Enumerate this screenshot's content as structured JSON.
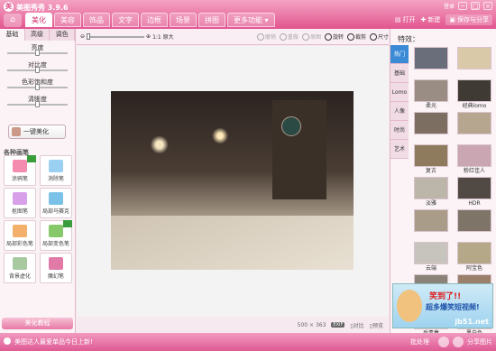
{
  "app": {
    "title": "美图秀秀 3.9.6",
    "logo_glyph": "美"
  },
  "window": {
    "login": "登录",
    "min": "−",
    "max": "□",
    "close": "×"
  },
  "menu_tabs": [
    {
      "label": "美化",
      "active": true
    },
    {
      "label": "美容",
      "active": false
    },
    {
      "label": "饰品",
      "active": false
    },
    {
      "label": "文字",
      "active": false
    },
    {
      "label": "边框",
      "active": false
    },
    {
      "label": "场景",
      "active": false
    },
    {
      "label": "拼图",
      "active": false
    },
    {
      "label": "更多功能 ▾",
      "active": false
    }
  ],
  "actions": {
    "open": "打开",
    "new": "新建",
    "save": "保存与分享"
  },
  "left_panel": {
    "tabs": [
      "基础",
      "高级",
      "调色"
    ],
    "sliders": [
      {
        "label": "亮度",
        "value": 0.5
      },
      {
        "label": "对比度",
        "value": 0.5
      },
      {
        "label": "色彩饱和度",
        "value": 0.5
      },
      {
        "label": "清晰度",
        "value": 0.5
      }
    ],
    "auto_button": "一键美化",
    "section_title": "各种画笔",
    "tools": [
      {
        "label": "涂鸦笔",
        "color": "#f48cb0",
        "hot": true
      },
      {
        "label": "消除笔",
        "color": "#9ad0f2",
        "hot": false
      },
      {
        "label": "抠图笔",
        "color": "#d7a0e8",
        "hot": false
      },
      {
        "label": "局部马赛克",
        "color": "#7bc2e8",
        "hot": false
      },
      {
        "label": "局部彩色笔",
        "color": "#f2b06a",
        "hot": false
      },
      {
        "label": "局部变色笔",
        "color": "#86c86a",
        "hot": true
      },
      {
        "label": "背景虚化",
        "color": "#a8c8a0",
        "hot": false
      },
      {
        "label": "魔幻笔",
        "color": "#e27aa8",
        "hot": false
      }
    ],
    "beauty_button": "美化教程"
  },
  "toolbar": {
    "zoom_label": "1:1 原大",
    "items": [
      {
        "label": "撤销",
        "enabled": false
      },
      {
        "label": "重做",
        "enabled": false
      },
      {
        "label": "原图",
        "enabled": false
      },
      {
        "label": "旋转",
        "enabled": true
      },
      {
        "label": "裁剪",
        "enabled": true
      },
      {
        "label": "尺寸",
        "enabled": true
      }
    ]
  },
  "status": {
    "size": "500 × 363",
    "exif": "EXIF",
    "compare": "对比",
    "preview": "预览"
  },
  "right_panel": {
    "title": "特效：",
    "tabs": [
      {
        "label": "热门",
        "active": true
      },
      {
        "label": "基础",
        "active": false
      },
      {
        "label": "Lomo",
        "active": false
      },
      {
        "label": "人像",
        "active": false
      },
      {
        "label": "时尚",
        "active": false
      },
      {
        "label": "艺术",
        "active": false
      }
    ],
    "effects": [
      {
        "label": "",
        "color": "#6a6e7a"
      },
      {
        "label": "",
        "color": "#d9c9a8"
      },
      {
        "label": "柔光",
        "color": "#9a8e84"
      },
      {
        "label": "经典lomo",
        "color": "#3f3a33"
      },
      {
        "label": "",
        "color": "#7c6f62"
      },
      {
        "label": "",
        "color": "#b6a68f"
      },
      {
        "label": "复古",
        "color": "#8e7a5c"
      },
      {
        "label": "粉红佳人",
        "color": "#c9a6b1"
      },
      {
        "label": "淡雅",
        "color": "#bcb5aa"
      },
      {
        "label": "HDR",
        "color": "#514a44"
      },
      {
        "label": "",
        "color": "#a99c88"
      },
      {
        "label": "",
        "color": "#7f7468"
      },
      {
        "label": "云端",
        "color": "#c7c3bd"
      },
      {
        "label": "阿宝色",
        "color": "#b4a889"
      },
      {
        "label": "",
        "color": "#8c8378"
      },
      {
        "label": "",
        "color": "#9b7f6a"
      },
      {
        "label": "后青春",
        "color": "#b8a49c"
      },
      {
        "label": "黑白色",
        "color": "#7d7d7d"
      }
    ],
    "ad": {
      "line1": "笑到了!!",
      "line2": "超多爆笑短视频!",
      "watermark": "jb51.net"
    }
  },
  "bottom": {
    "news": "美图达人最爱单品今日上新!",
    "batch": "批处理",
    "share": "分享图片"
  }
}
